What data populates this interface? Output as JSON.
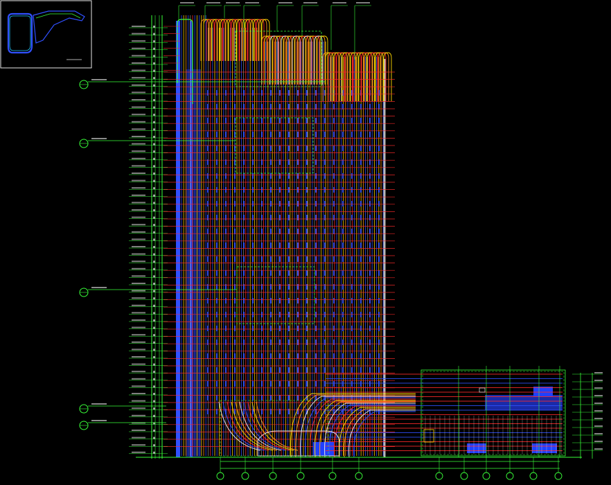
{
  "drawing": {
    "title": "",
    "background": "#000000",
    "colors": {
      "green": "#39ff39",
      "blue": "#3050ff",
      "red": "#ff2a2a",
      "yellow": "#ffd800",
      "orange": "#ff9a1a",
      "white": "#e8e8e8",
      "cyan": "#22c8ff",
      "magenta": "#ff40ff"
    }
  },
  "key_plan": {
    "label": "",
    "grid_marks": []
  },
  "section_markers": [],
  "level_labels": [],
  "grid_axes": [],
  "notes": []
}
